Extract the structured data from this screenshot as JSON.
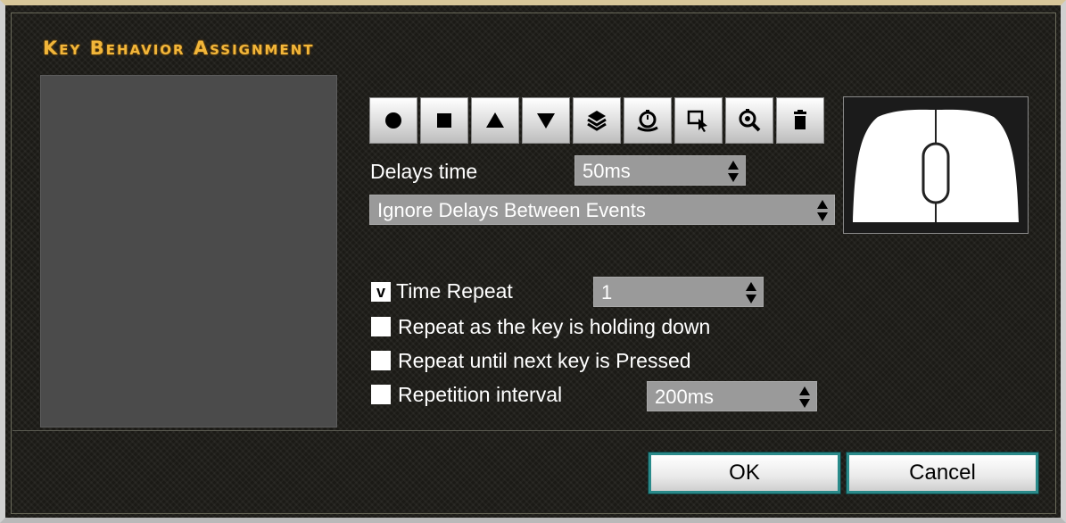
{
  "title": "Key Behavior Assignment",
  "toolbar": {
    "buttons": [
      {
        "icon": "record-icon"
      },
      {
        "icon": "stop-icon"
      },
      {
        "icon": "move-up-icon"
      },
      {
        "icon": "move-down-icon"
      },
      {
        "icon": "layers-icon"
      },
      {
        "icon": "timer-icon"
      },
      {
        "icon": "select-icon"
      },
      {
        "icon": "zoom-timer-icon"
      },
      {
        "icon": "trash-icon"
      }
    ]
  },
  "delays": {
    "label": "Delays time",
    "value": "50ms",
    "mode": "Ignore Delays Between Events"
  },
  "repeat": {
    "time_repeat_label": "Time Repeat",
    "time_repeat_checked": true,
    "time_repeat_check_glyph": "v",
    "time_repeat_value": "1",
    "holding_label": "Repeat as the key is holding down",
    "holding_checked": false,
    "until_next_label": "Repeat until next key is Pressed",
    "until_next_checked": false,
    "interval_label": "Repetition interval",
    "interval_checked": false,
    "interval_value": "200ms"
  },
  "buttons": {
    "ok": "OK",
    "cancel": "Cancel"
  },
  "colors": {
    "title": "#f2b63a",
    "select_bg": "#9a9a9a",
    "button_border": "#2a8a8a"
  }
}
